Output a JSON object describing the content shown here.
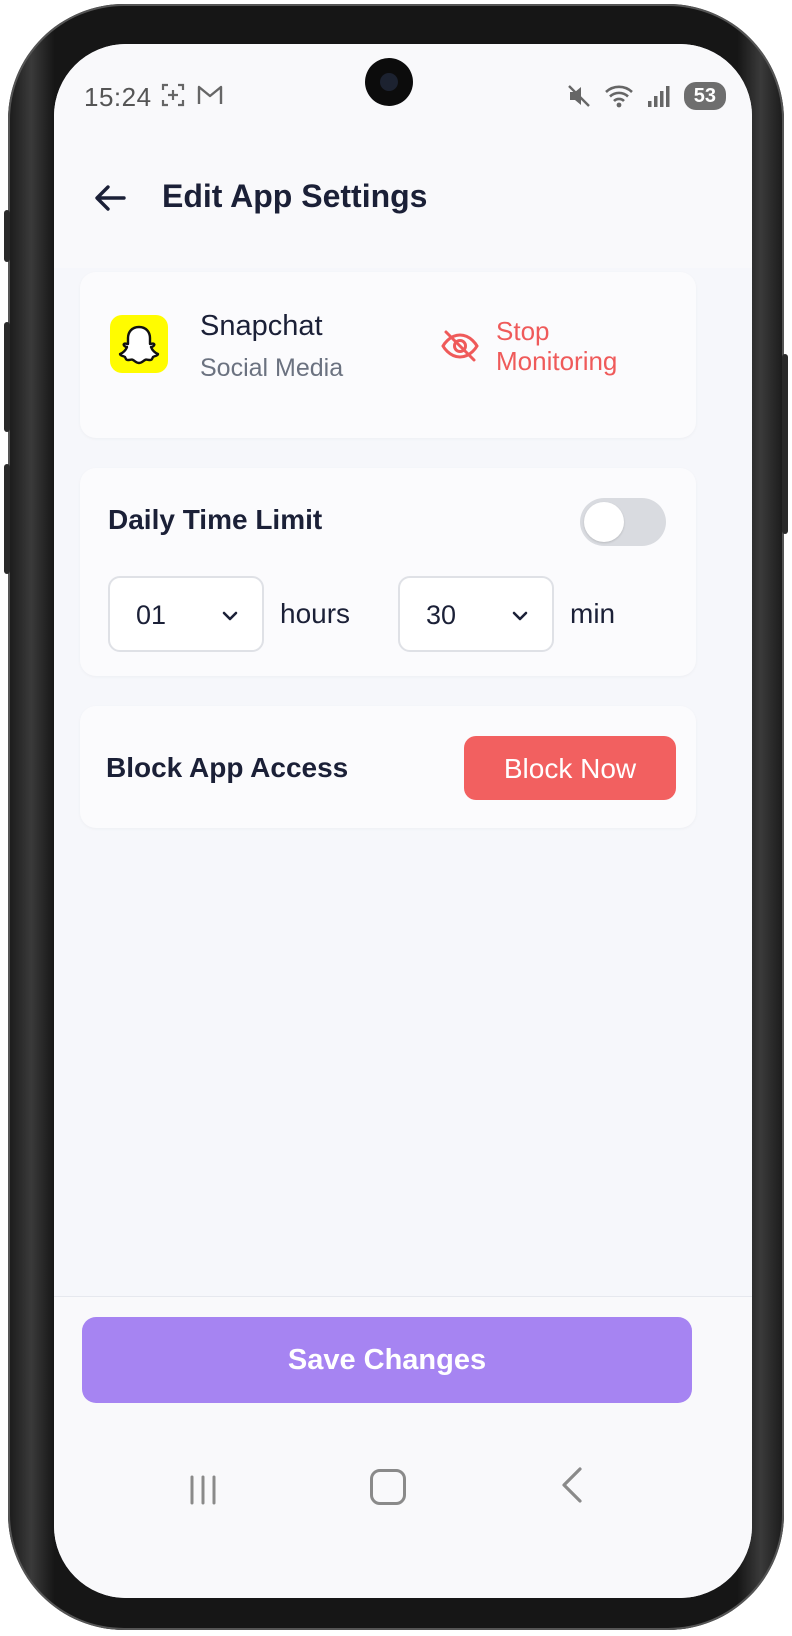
{
  "status_bar": {
    "time": "15:24",
    "battery": "53",
    "left_icons": [
      "screenshot-icon",
      "gmail-icon"
    ],
    "right_icons": [
      "mute-icon",
      "wifi-icon",
      "signal-icon"
    ]
  },
  "header": {
    "title": "Edit App Settings",
    "back_icon": "arrow-left-icon"
  },
  "app": {
    "name": "Snapchat",
    "category": "Social Media",
    "icon_color": "#FFFC00",
    "stop_monitoring_label": "Stop\nMonitoring"
  },
  "time_limit": {
    "title": "Daily Time Limit",
    "enabled": false,
    "hours_value": "01",
    "hours_unit": "hours",
    "minutes_value": "30",
    "minutes_unit": "min"
  },
  "block": {
    "title": "Block App Access",
    "button_label": "Block Now"
  },
  "footer": {
    "save_label": "Save Changes"
  },
  "colors": {
    "accent_purple": "#A684F2",
    "danger_red": "#F26060",
    "text_dark": "#1B2037"
  }
}
